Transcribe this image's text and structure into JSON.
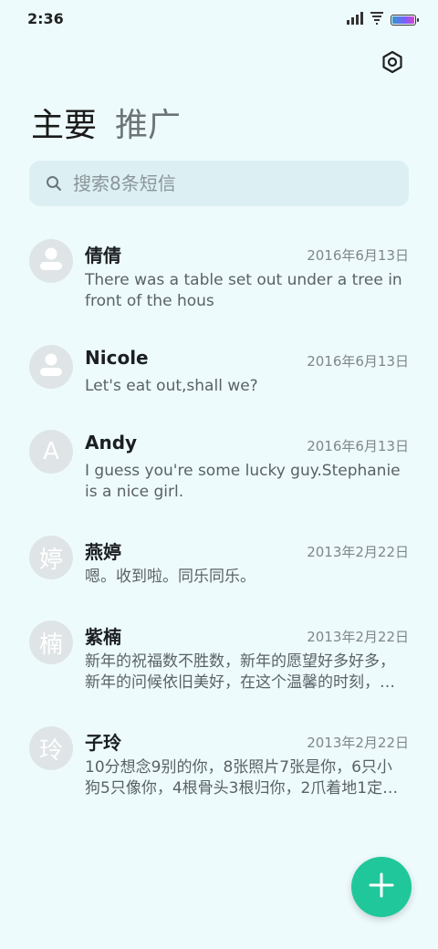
{
  "status_bar": {
    "time": "2:36",
    "icons": [
      "signal-icon",
      "wifi-icon",
      "battery-icon"
    ],
    "battery_level": 1.0
  },
  "toolbar": {
    "settings_icon": "settings-icon"
  },
  "tabs": [
    {
      "label": "主要",
      "active": true
    },
    {
      "label": "推广",
      "active": false
    }
  ],
  "search": {
    "placeholder": "搜索8条短信",
    "value": ""
  },
  "messages": [
    {
      "name": "倩倩",
      "date": "2016年6月13日",
      "snippet": "There was a table set out under a tree in front of the hous",
      "avatar": "person-icon"
    },
    {
      "name": "Nicole",
      "date": "2016年6月13日",
      "snippet": "Let's eat out,shall we?",
      "avatar": "person-icon"
    },
    {
      "name": "Andy",
      "date": "2016年6月13日",
      "snippet": "I guess you're some lucky guy.Stephanie is a nice girl.",
      "avatar_letter": "A"
    },
    {
      "name": "燕婷",
      "date": "2013年2月22日",
      "snippet": "嗯。收到啦。同乐同乐。",
      "avatar_letter": "婷"
    },
    {
      "name": "紫楠",
      "date": "2013年2月22日",
      "snippet": "新年的祝福数不胜数，新年的愿望好多好多，新年的问候依旧美好，在这个温馨的时刻，…",
      "avatar_letter": "楠"
    },
    {
      "name": "子玲",
      "date": "2013年2月22日",
      "snippet": "10分想念9别的你，8张照片7张是你，6只小狗5只像你，4根骨头3根归你，2爪着地1定…",
      "avatar_letter": "玲"
    }
  ],
  "fab": {
    "icon": "plus-icon"
  },
  "colors": {
    "background": "#eefbfd",
    "search_bg": "#dcf0f3",
    "fab": "#20c79b",
    "avatar_bg": "#dfe4e6"
  }
}
